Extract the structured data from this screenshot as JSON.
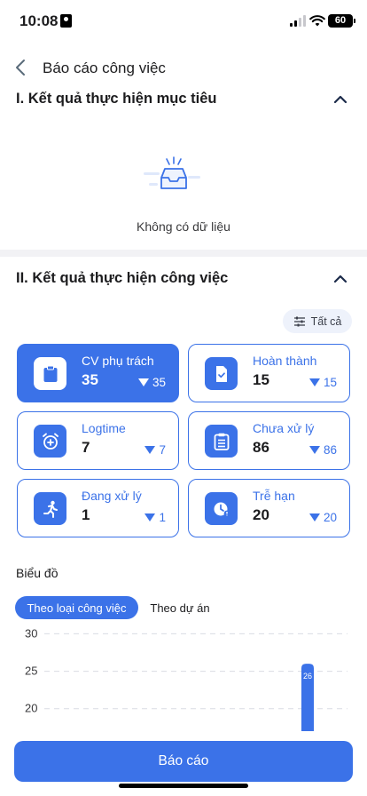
{
  "status": {
    "time": "10:08",
    "battery": "60"
  },
  "header": {
    "title": "Báo cáo công việc"
  },
  "section1": {
    "title": "I. Kết quả thực hiện mục tiêu",
    "empty_text": "Không có dữ liệu"
  },
  "section2": {
    "title": "II. Kết quả thực hiện công việc",
    "filter_label": "Tất cả",
    "cards": [
      {
        "label": "CV phụ trách",
        "value": "35",
        "delta": "35"
      },
      {
        "label": "Hoàn thành",
        "value": "15",
        "delta": "15"
      },
      {
        "label": "Logtime",
        "value": "7",
        "delta": "7"
      },
      {
        "label": "Chưa xử lý",
        "value": "86",
        "delta": "86"
      },
      {
        "label": "Đang xử lý",
        "value": "1",
        "delta": "1"
      },
      {
        "label": "Trễ hạn",
        "value": "20",
        "delta": "20"
      }
    ]
  },
  "chart": {
    "title": "Biểu đồ",
    "tabs": {
      "active": "Theo loại công việc",
      "inactive": "Theo dự án"
    }
  },
  "chart_data": {
    "type": "bar",
    "y_ticks": [
      "30",
      "25",
      "20"
    ],
    "ylim": [
      17,
      31
    ],
    "values": [
      26
    ],
    "value_labels": [
      "26"
    ]
  },
  "report_button": {
    "label": "Báo cáo"
  },
  "colors": {
    "accent": "#3b72e8",
    "divider": "#f2f2f5"
  }
}
